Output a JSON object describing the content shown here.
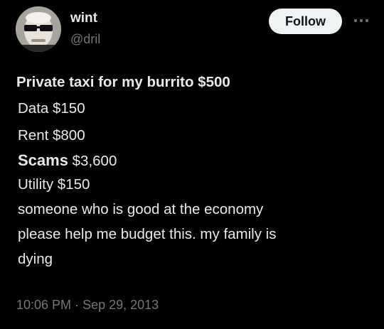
{
  "author": {
    "display_name": "wint",
    "handle": "@dril",
    "avatar_icon": "avatar-icon"
  },
  "actions": {
    "follow_label": "Follow",
    "more_icon": "more-options-icon"
  },
  "tweet": {
    "lines": [
      "Private taxi for my burrito $500",
      "Data $150",
      "Rent $800",
      "Utility $150",
      "someone who is good at the economy",
      "please help me budget this. my family is",
      "dying"
    ],
    "scams_label": "Scams",
    "scams_amount": "$3,600"
  },
  "meta": {
    "time": "10:06 PM",
    "separator": "·",
    "date": "Sep 29, 2013"
  },
  "colors": {
    "background": "#000000",
    "text": "#e7e9ea",
    "secondary": "#71767b",
    "button_bg": "#eff3f4",
    "button_text": "#0f1419"
  }
}
